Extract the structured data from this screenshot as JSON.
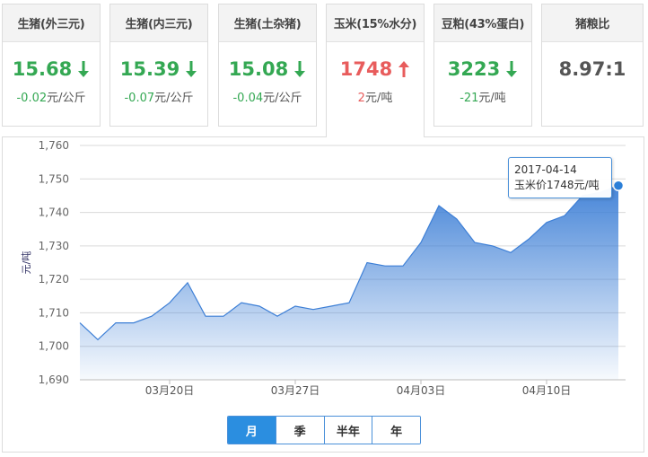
{
  "cards": [
    {
      "title": "生猪(外三元)",
      "value": "15.68",
      "direction": "down",
      "change": "-0.02",
      "unit": "元/公斤"
    },
    {
      "title": "生猪(内三元)",
      "value": "15.39",
      "direction": "down",
      "change": "-0.07",
      "unit": "元/公斤"
    },
    {
      "title": "生猪(土杂猪)",
      "value": "15.08",
      "direction": "down",
      "change": "-0.04",
      "unit": "元/公斤"
    },
    {
      "title": "玉米(15%水分)",
      "value": "1748",
      "direction": "up",
      "change": "2",
      "unit": "元/吨"
    },
    {
      "title": "豆粕(43%蛋白)",
      "value": "3223",
      "direction": "down",
      "change": "-21",
      "unit": "元/吨"
    },
    {
      "title": "猪粮比",
      "value": "8.97:1",
      "direction": "neutral",
      "change": "",
      "unit": ""
    }
  ],
  "colors": {
    "down": "#34a853",
    "up": "#e85c5c",
    "line": "#3d7fd6",
    "accent": "#2b8ee0"
  },
  "icons": {
    "down": "arrow-down-icon",
    "up": "arrow-up-icon"
  },
  "tooltip": {
    "date": "2017-04-14",
    "text": "玉米价1748元/吨"
  },
  "range_tabs": [
    {
      "label": "月",
      "selected": true
    },
    {
      "label": "季",
      "selected": false
    },
    {
      "label": "半年",
      "selected": false
    },
    {
      "label": "年",
      "selected": false
    }
  ],
  "chart_data": {
    "type": "area",
    "ylabel": "元/吨",
    "ylim": [
      1690,
      1760
    ],
    "yticks": [
      1690,
      1700,
      1710,
      1720,
      1730,
      1740,
      1750,
      1760
    ],
    "ytick_labels": [
      "1,690",
      "1,700",
      "1,710",
      "1,720",
      "1,730",
      "1,740",
      "1,750",
      "1,760"
    ],
    "xtick_labels": [
      "03月20日",
      "03月27日",
      "04月03日",
      "04月10日"
    ],
    "xtick_indices": [
      5,
      12,
      19,
      26
    ],
    "grid": true,
    "series": [
      {
        "values": [
          1707,
          1702,
          1707,
          1707,
          1709,
          1713,
          1719,
          1709,
          1709,
          1713,
          1712,
          1709,
          1712,
          1711,
          1712,
          1713,
          1725,
          1724,
          1724,
          1731,
          1742,
          1738,
          1731,
          1730,
          1728,
          1732,
          1737,
          1739,
          1745,
          1746,
          1748
        ]
      }
    ]
  }
}
